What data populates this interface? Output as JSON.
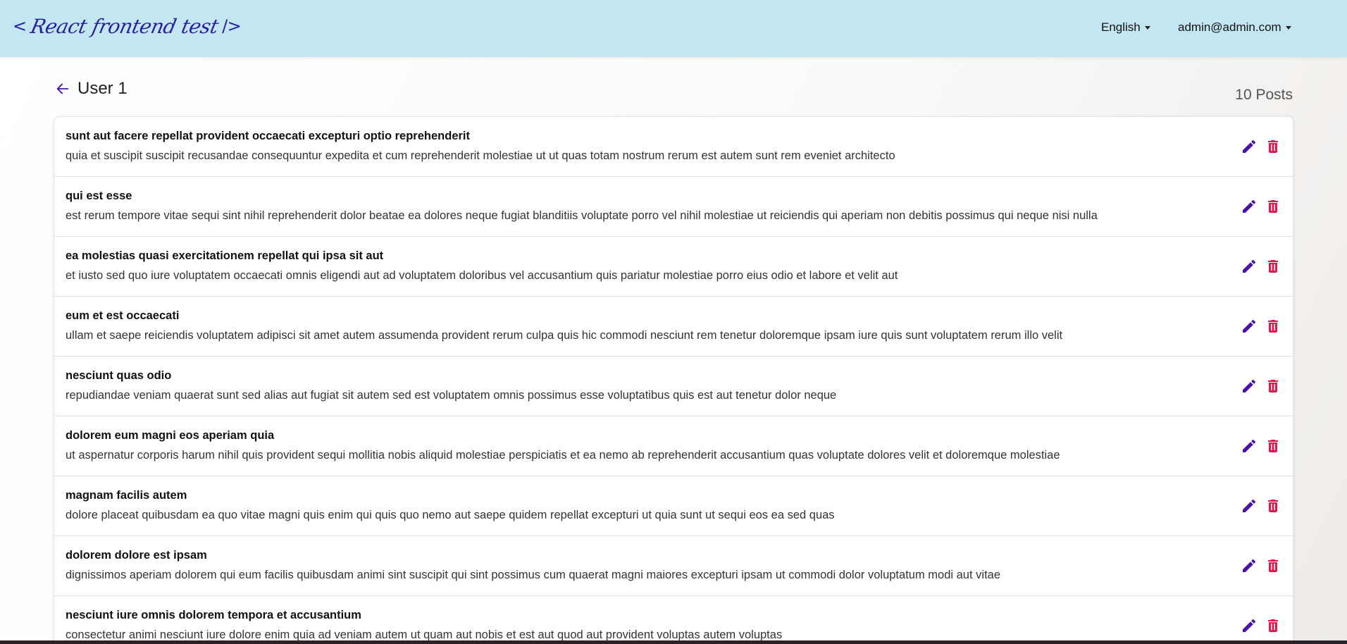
{
  "app": {
    "logo_text": "React frontend test",
    "logo_open": "<",
    "logo_close": "/>"
  },
  "nav": {
    "language": "English",
    "user_email": "admin@admin.com"
  },
  "page": {
    "title": "User 1",
    "posts_count": "10 Posts"
  },
  "colors": {
    "navbar": "#c2e7f3",
    "edit_icon": "#4b12a8",
    "delete_icon": "#e8144a"
  },
  "icons": {
    "back": "arrow-left-icon",
    "edit": "pencil-icon",
    "delete": "trash-icon"
  },
  "posts": [
    {
      "title": "sunt aut facere repellat provident occaecati excepturi optio reprehenderit",
      "body": "quia et suscipit suscipit recusandae consequuntur expedita et cum reprehenderit molestiae ut ut quas totam nostrum rerum est autem sunt rem eveniet architecto"
    },
    {
      "title": "qui est esse",
      "body": "est rerum tempore vitae sequi sint nihil reprehenderit dolor beatae ea dolores neque fugiat blanditiis voluptate porro vel nihil molestiae ut reiciendis qui aperiam non debitis possimus qui neque nisi nulla"
    },
    {
      "title": "ea molestias quasi exercitationem repellat qui ipsa sit aut",
      "body": "et iusto sed quo iure voluptatem occaecati omnis eligendi aut ad voluptatem doloribus vel accusantium quis pariatur molestiae porro eius odio et labore et velit aut"
    },
    {
      "title": "eum et est occaecati",
      "body": "ullam et saepe reiciendis voluptatem adipisci sit amet autem assumenda provident rerum culpa quis hic commodi nesciunt rem tenetur doloremque ipsam iure quis sunt voluptatem rerum illo velit"
    },
    {
      "title": "nesciunt quas odio",
      "body": "repudiandae veniam quaerat sunt sed alias aut fugiat sit autem sed est voluptatem omnis possimus esse voluptatibus quis est aut tenetur dolor neque"
    },
    {
      "title": "dolorem eum magni eos aperiam quia",
      "body": "ut aspernatur corporis harum nihil quis provident sequi mollitia nobis aliquid molestiae perspiciatis et ea nemo ab reprehenderit accusantium quas voluptate dolores velit et doloremque molestiae"
    },
    {
      "title": "magnam facilis autem",
      "body": "dolore placeat quibusdam ea quo vitae magni quis enim qui quis quo nemo aut saepe quidem repellat excepturi ut quia sunt ut sequi eos ea sed quas"
    },
    {
      "title": "dolorem dolore est ipsam",
      "body": "dignissimos aperiam dolorem qui eum facilis quibusdam animi sint suscipit qui sint possimus cum quaerat magni maiores excepturi ipsam ut commodi dolor voluptatum modi aut vitae"
    },
    {
      "title": "nesciunt iure omnis dolorem tempora et accusantium",
      "body": "consectetur animi nesciunt iure dolore enim quia ad veniam autem ut quam aut nobis et est aut quod aut provident voluptas autem voluptas"
    }
  ]
}
